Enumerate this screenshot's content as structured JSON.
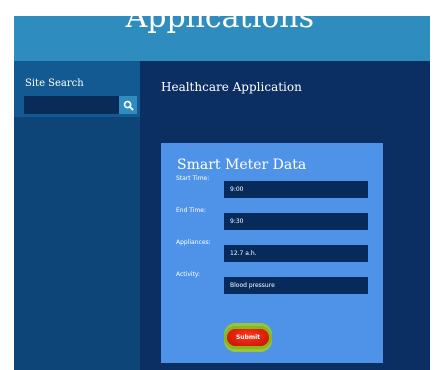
{
  "header": {
    "title": "Applications"
  },
  "sidebar": {
    "search_label": "Site Search",
    "search_value": "",
    "search_icon": "search-icon"
  },
  "main": {
    "heading": "Healthcare Application",
    "form": {
      "title": "Smart Meter Data",
      "fields": [
        {
          "label": "Start Time:",
          "value": "9:00"
        },
        {
          "label": "End Time:",
          "value": "9:30"
        },
        {
          "label": "Appliances:",
          "value": "12.7 a.h."
        },
        {
          "label": "Activity:",
          "value": "Blood pressure"
        }
      ],
      "submit_label": "Submit"
    }
  },
  "colors": {
    "header_bg": "#2f8cbe",
    "page_bg": "#0b2e63",
    "sidebar_bg": "#0d4579",
    "card_bg": "#4f93e9",
    "input_bg": "#072a5c",
    "submit_red": "#e0200c",
    "submit_green": "#86b81c"
  }
}
